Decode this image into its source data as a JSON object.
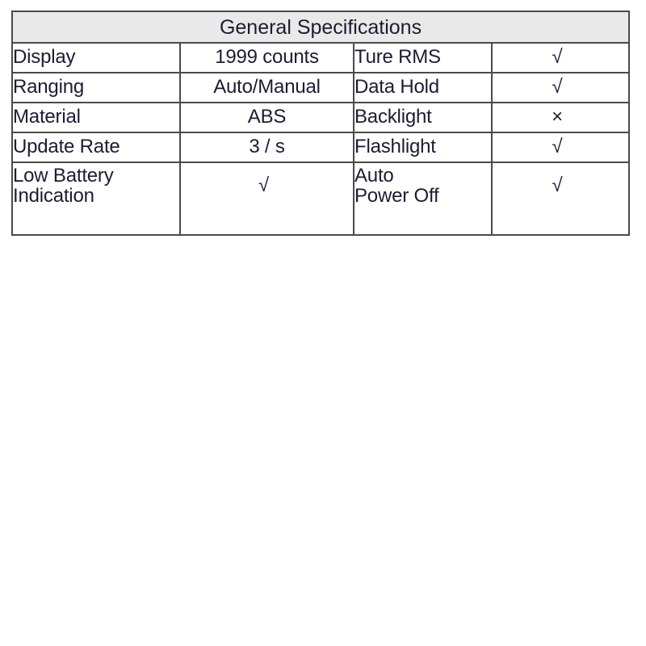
{
  "table": {
    "title": "General Specifications",
    "accent_border_color": "#4a4a4a",
    "header_fill_color": "#e9e9e9",
    "text_color": "#1c1c33",
    "rows": [
      {
        "label": "Display",
        "value": "1999 counts",
        "feature": "Ture RMS",
        "feature_line2": "",
        "mark": "√"
      },
      {
        "label": "Ranging",
        "value": "Auto/Manual",
        "feature": "Data Hold",
        "feature_line2": "",
        "mark": "√"
      },
      {
        "label": "Material",
        "value": "ABS",
        "feature": "Backlight",
        "feature_line2": "",
        "mark": "×"
      },
      {
        "label": "Update Rate",
        "value": "3 / s",
        "feature": "Flashlight",
        "feature_line2": "",
        "mark": "√"
      },
      {
        "label": "Low Battery",
        "label_line2": "Indication",
        "value": "√",
        "feature": "Auto",
        "feature_line2": "Power Off",
        "mark": "√"
      }
    ]
  }
}
